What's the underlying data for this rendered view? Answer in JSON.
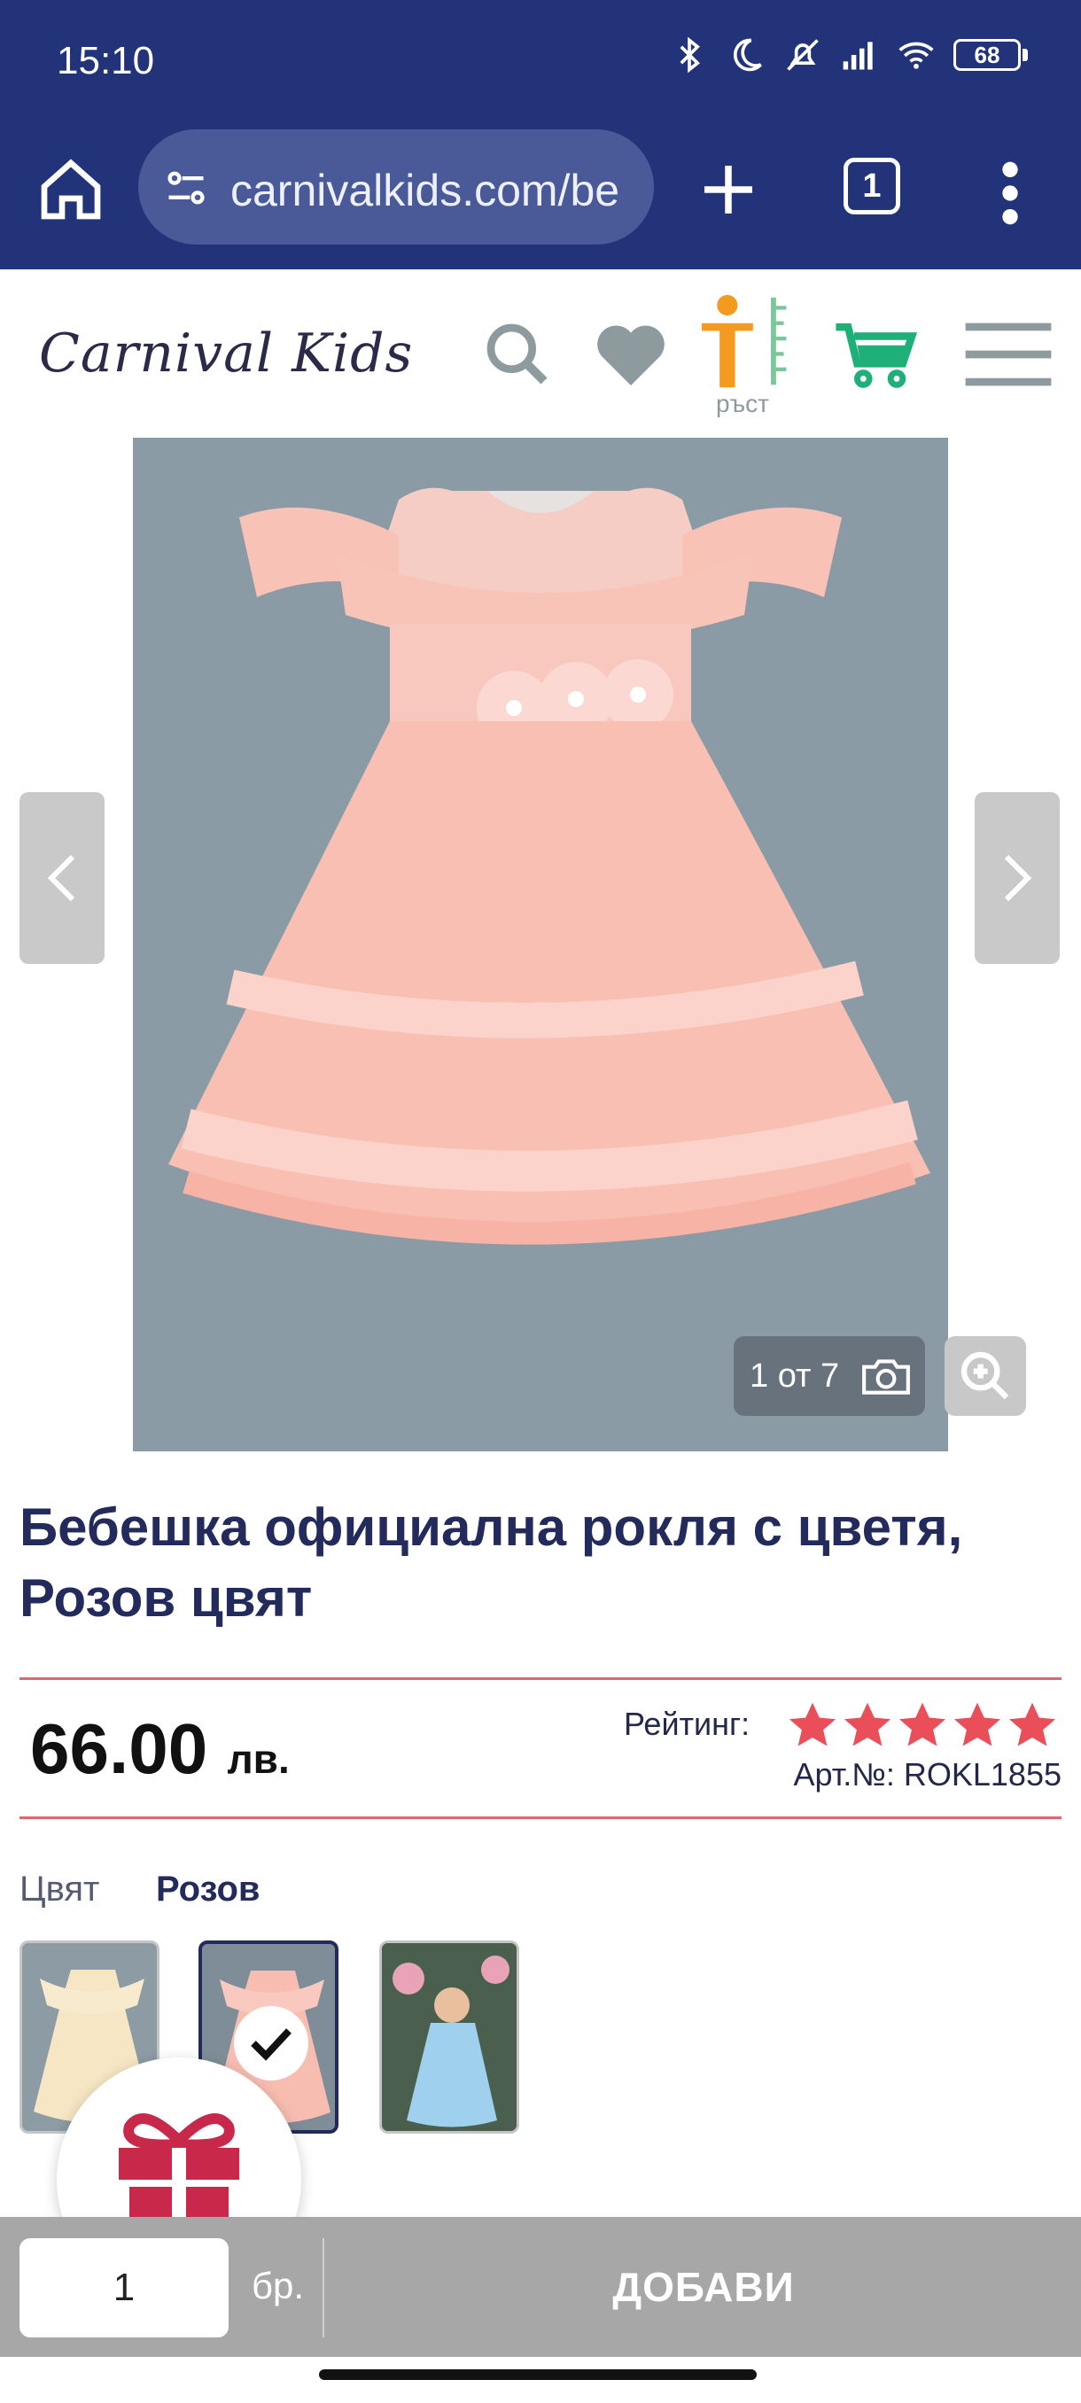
{
  "status_bar": {
    "time": "15:10",
    "battery": "68"
  },
  "browser": {
    "url": "carnivalkids.com/be",
    "tab_count": "1"
  },
  "site": {
    "logo": "Carnival Kids",
    "growth_label": "ръст"
  },
  "gallery": {
    "counter": "1 от 7"
  },
  "product": {
    "title": "Бебешка официална рокля с цветя, Розов цвят",
    "price_value": "66.00",
    "price_currency": "лв.",
    "rating_label": "Рейтинг:",
    "rating_stars": 5,
    "sku": "Арт.№: ROKL1855",
    "color_label": "Цвят",
    "color_value": "Розов"
  },
  "cart": {
    "quantity": "1",
    "unit": "бр.",
    "add_label": "ДОБАВИ"
  },
  "colors": {
    "brand_navy": "#22337a",
    "title_navy": "#232a5c",
    "star_red": "#ea4f59",
    "rule_red": "#e0666e",
    "gift_red": "#c8284a",
    "cart_green": "#1fb07a",
    "growth_orange": "#f39a1f"
  }
}
